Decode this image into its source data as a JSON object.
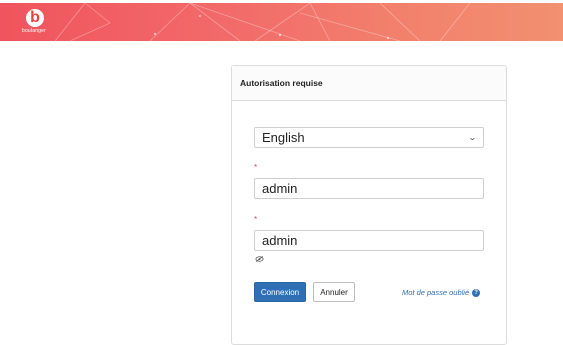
{
  "header": {
    "logo_text": "boulanger",
    "logo_letter": "b",
    "background_color": "#f26a6a"
  },
  "login": {
    "title": "Autorisation requise",
    "language": {
      "selected": "English"
    },
    "required_marker": "*",
    "username": {
      "value": "admin"
    },
    "password": {
      "value": "admin"
    },
    "show_password_icon": "eye-slash-icon",
    "submit_label": "Connexion",
    "cancel_label": "Annuler",
    "forgot_label": "Mot de passe oublié",
    "help_icon_symbol": "?"
  },
  "colors": {
    "primary": "#2f6fb3",
    "required": "#e04848"
  }
}
